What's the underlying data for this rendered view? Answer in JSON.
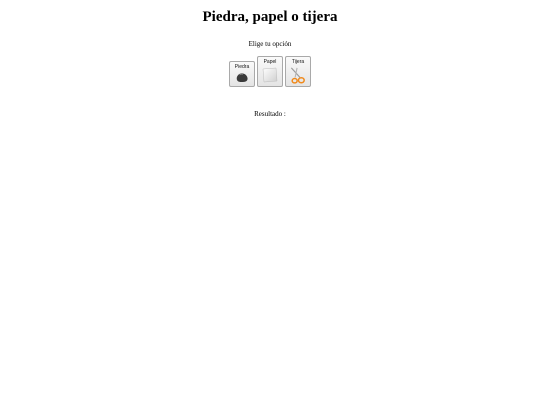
{
  "page": {
    "title": "Piedra, papel o tijera",
    "prompt": "Elige tu opción",
    "result_label": "Resultado :",
    "result_value": ""
  },
  "choices": [
    {
      "label": "Piedra",
      "icon": "rock-icon"
    },
    {
      "label": "Papel",
      "icon": "paper-icon"
    },
    {
      "label": "Tijera",
      "icon": "scissors-icon"
    }
  ],
  "colors": {
    "rock": "#3a3a3a",
    "scissors_handle": "#f08a1c"
  }
}
